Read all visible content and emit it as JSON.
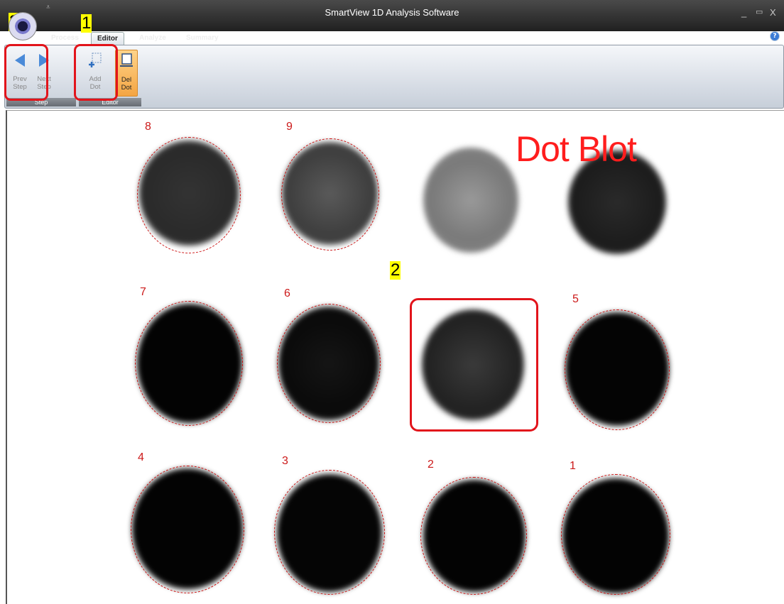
{
  "window": {
    "title": "SmartView 1D Analysis Software",
    "controls": [
      "_",
      "▭",
      "X"
    ]
  },
  "tabs": [
    "Process",
    "Editor",
    "Analyze",
    "Summary"
  ],
  "active_tab": "Editor",
  "ribbon": {
    "groups": [
      {
        "label": "Step",
        "buttons": [
          {
            "line1": "Prev",
            "line2": "Step",
            "icon": "left-arrow-icon"
          },
          {
            "line1": "Next",
            "line2": "Step",
            "icon": "right-arrow-icon"
          }
        ]
      },
      {
        "label": "Editor",
        "buttons": [
          {
            "line1": "Add",
            "line2": "Dot",
            "icon": "add-dot-icon"
          },
          {
            "line1": "Del",
            "line2": "Dot",
            "icon": "del-dot-icon"
          }
        ]
      }
    ]
  },
  "canvas": {
    "title": "Dot Blot",
    "dot_labels": [
      "1",
      "2",
      "3",
      "4",
      "5",
      "6",
      "7",
      "8",
      "9"
    ]
  },
  "callouts": {
    "marker_1": "1",
    "marker_2": "2",
    "marker_3": "3"
  },
  "colors": {
    "accent": "#e2141b",
    "highlight": "#ffff00",
    "dot_outline": "#cc1111"
  }
}
